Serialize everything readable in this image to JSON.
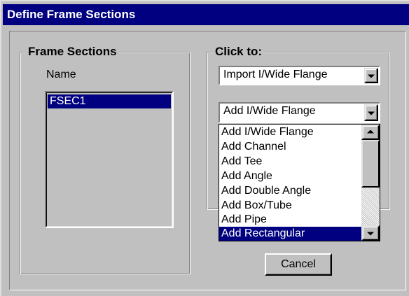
{
  "window": {
    "title": "Define Frame Sections"
  },
  "frame_sections": {
    "legend": "Frame Sections",
    "name_label": "Name",
    "items": [
      "FSEC1"
    ]
  },
  "click_to": {
    "legend": "Click to:",
    "import_combo_value": "Import I/Wide Flange",
    "add_combo_value": "Add I/Wide Flange",
    "add_options": [
      "Add I/Wide Flange",
      "Add Channel",
      "Add Tee",
      "Add Angle",
      "Add Double Angle",
      "Add Box/Tube",
      "Add Pipe",
      "Add Rectangular"
    ],
    "highlighted_option": "Add Rectangular"
  },
  "buttons": {
    "cancel_label": "Cancel"
  },
  "icons": {
    "combo_arrow": "chevron-down-icon",
    "scroll_up": "arrow-up-icon",
    "scroll_down": "arrow-down-icon"
  },
  "colors": {
    "title_bar": "#000080",
    "selection": "#000080",
    "face": "#c0c0c0"
  }
}
